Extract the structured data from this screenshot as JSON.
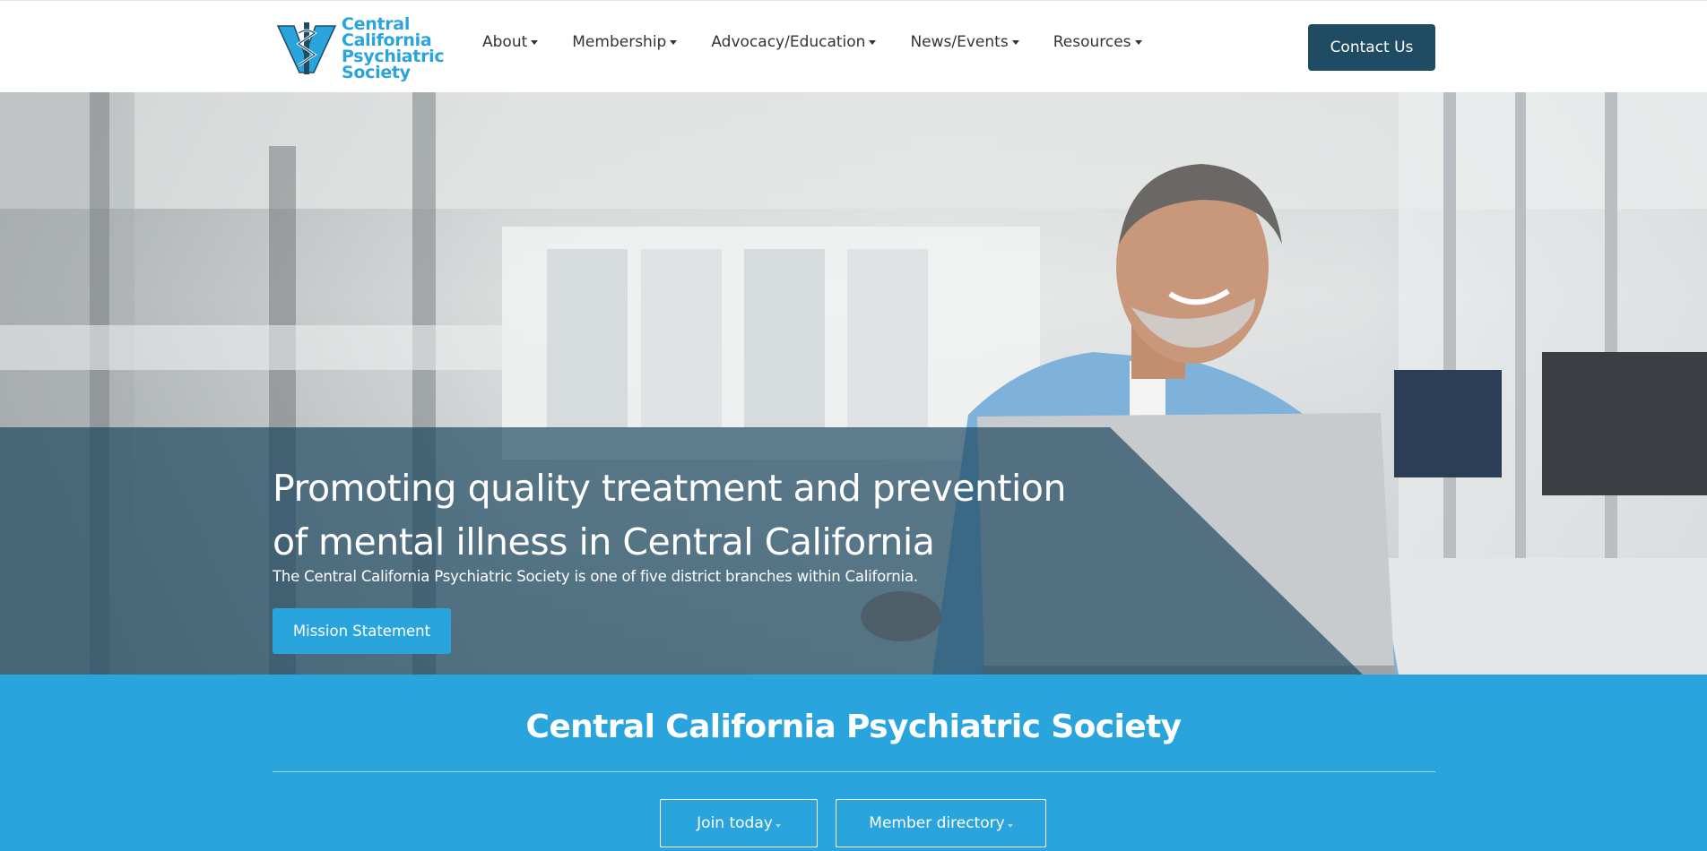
{
  "header": {
    "logo_lines": [
      "Central",
      "California",
      "Psychiatric",
      "Society"
    ],
    "nav": [
      {
        "label": "About"
      },
      {
        "label": "Membership"
      },
      {
        "label": "Advocacy/Education"
      },
      {
        "label": "News/Events"
      },
      {
        "label": "Resources"
      }
    ],
    "contact_label": "Contact Us"
  },
  "hero": {
    "title": "Promoting quality treatment and prevention of mental illness in Central California",
    "subtitle": "The Central California Psychiatric Society is one of five district branches within California.",
    "cta_label": "Mission Statement"
  },
  "band": {
    "title": "Central California Psychiatric Society",
    "buttons": [
      {
        "label": "Join today"
      },
      {
        "label": "Member directory"
      }
    ]
  },
  "colors": {
    "brand_blue": "#2aa4dd",
    "navy": "#1f4b63",
    "hero_overlay": "#1d4a62"
  }
}
